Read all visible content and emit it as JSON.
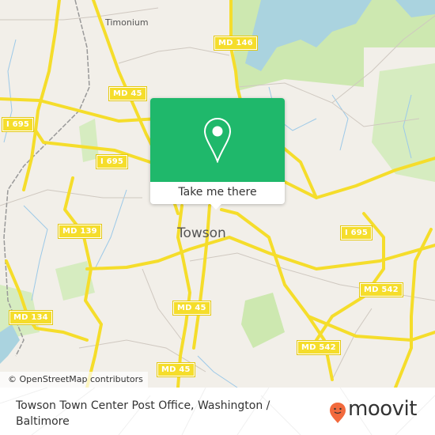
{
  "map": {
    "places": [
      {
        "name": "Timonium",
        "size": "small"
      },
      {
        "name": "Towson",
        "size": "big"
      }
    ],
    "shields": [
      {
        "id": "md146",
        "label": "MD 146"
      },
      {
        "id": "md45-top",
        "label": "MD 45"
      },
      {
        "id": "i695-left",
        "label": "I 695"
      },
      {
        "id": "i695-mid",
        "label": "I 695"
      },
      {
        "id": "i695-right",
        "label": "I 695"
      },
      {
        "id": "md139",
        "label": "MD 139"
      },
      {
        "id": "md134",
        "label": "MD 134"
      },
      {
        "id": "md45-mid",
        "label": "MD 45"
      },
      {
        "id": "md542-upper",
        "label": "MD 542"
      },
      {
        "id": "md542-lower",
        "label": "MD 542"
      },
      {
        "id": "md45-bottom",
        "label": "MD 45"
      }
    ],
    "attribution": "© OpenStreetMap contributors",
    "colors": {
      "land": "#f2efe9",
      "water": "#aad3df",
      "park": "#cde8b0",
      "road": "#f5dd2b",
      "accent": "#1fb86b"
    }
  },
  "popup": {
    "icon": "map-pin-icon",
    "button_label": "Take me there"
  },
  "footer": {
    "title": "Towson Town Center Post Office, Washington / Baltimore",
    "brand": "moovit",
    "brand_color": "#f26a3d"
  }
}
